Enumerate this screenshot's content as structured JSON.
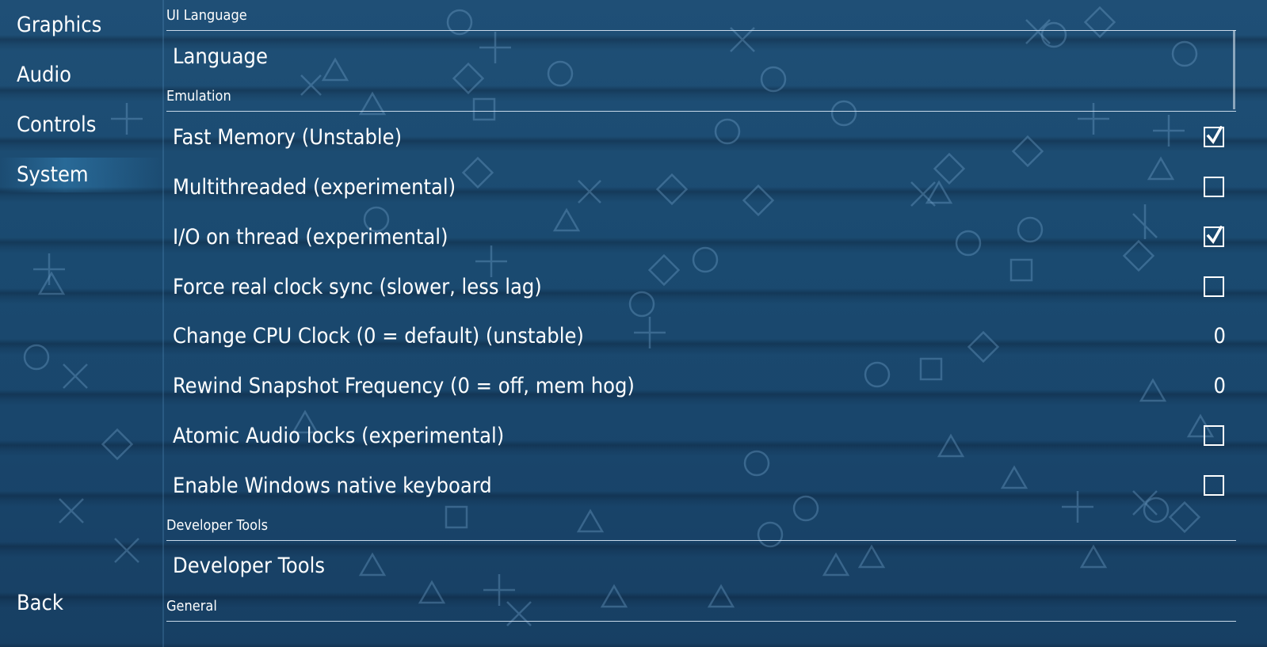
{
  "sidebar": {
    "items": [
      {
        "label": "Graphics"
      },
      {
        "label": "Audio"
      },
      {
        "label": "Controls"
      },
      {
        "label": "System",
        "selected": true
      }
    ],
    "back_label": "Back"
  },
  "sections": {
    "ui_language": {
      "header": "UI Language",
      "language_label": "Language"
    },
    "emulation": {
      "header": "Emulation",
      "rows": [
        {
          "label": "Fast Memory (Unstable)",
          "type": "checkbox",
          "checked": true
        },
        {
          "label": "Multithreaded (experimental)",
          "type": "checkbox",
          "checked": false
        },
        {
          "label": "I/O on thread (experimental)",
          "type": "checkbox",
          "checked": true
        },
        {
          "label": "Force real clock sync (slower, less lag)",
          "type": "checkbox",
          "checked": false
        },
        {
          "label": "Change CPU Clock (0 = default) (unstable)",
          "type": "value",
          "value": "0"
        },
        {
          "label": "Rewind Snapshot Frequency (0 = off, mem hog)",
          "type": "value",
          "value": "0"
        },
        {
          "label": "Atomic Audio locks (experimental)",
          "type": "checkbox",
          "checked": false
        },
        {
          "label": "Enable Windows native keyboard",
          "type": "checkbox",
          "checked": false
        }
      ]
    },
    "developer_tools": {
      "header": "Developer Tools",
      "row_label": "Developer Tools"
    },
    "general": {
      "header": "General"
    }
  },
  "colors": {
    "background": "#1b4a70",
    "text": "#ffffff",
    "rule": "#c8d8e8"
  },
  "icons": {
    "checkmark": "check-icon",
    "background_symbols": [
      "circle-icon",
      "cross-icon",
      "square-icon",
      "triangle-icon"
    ]
  }
}
